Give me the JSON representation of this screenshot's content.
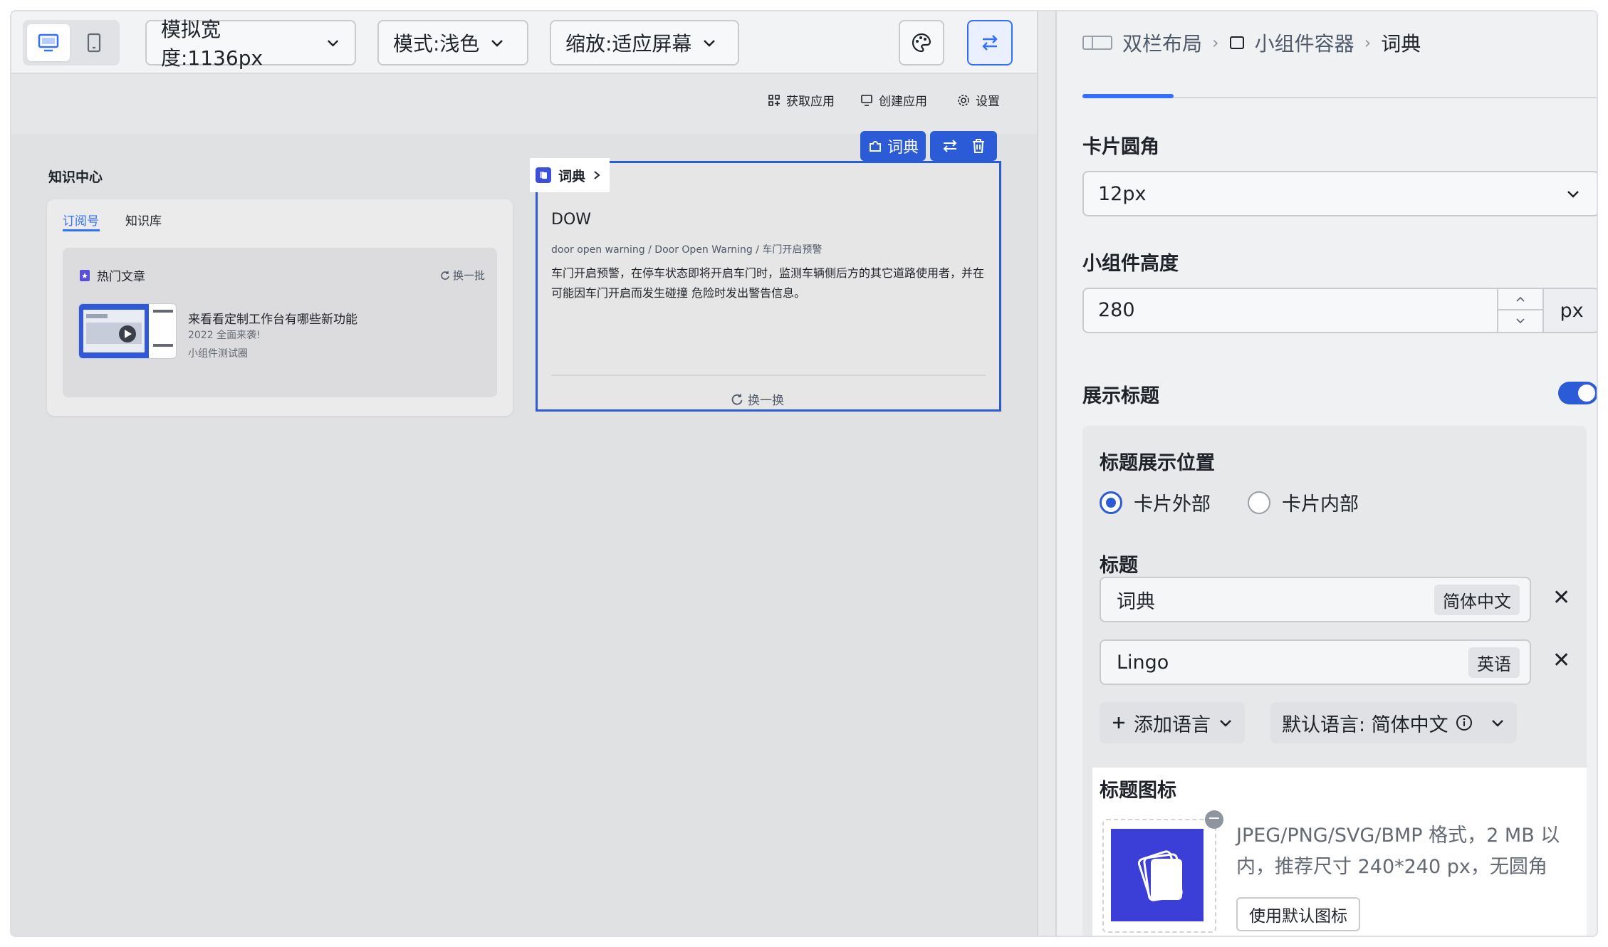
{
  "toolbar": {
    "width_label": "模拟宽度:1136px",
    "mode_label": "模式:浅色",
    "zoom_label": "缩放:适应屏幕"
  },
  "subbar": {
    "get_app": "获取应用",
    "create_app": "创建应用",
    "settings": "设置"
  },
  "canvas": {
    "knowledge_center": {
      "title": "知识中心",
      "tabs": [
        "订阅号",
        "知识库"
      ],
      "hot": {
        "title": "热门文章",
        "refresh": "换一批",
        "article_title": "来看看定制工作台有哪些新功能",
        "article_sub": "2022 全面来袭!",
        "article_meta": "小组件测试圈"
      }
    },
    "dictionary": {
      "tag_label": "词典",
      "toolbar_label": "词典",
      "word": "DOW",
      "phonetic": "door open warning / Door Open Warning / 车门开启预警",
      "definition": "车门开启预警，在停车状态即将开启车门时，监测车辆侧后方的其它道路使用者，并在可能因车门开启而发生碰撞 危险时发出警告信息。",
      "refresh": "换一换"
    }
  },
  "panel": {
    "breadcrumb": [
      "双栏布局",
      "小组件容器",
      "词典"
    ],
    "corner_label": "卡片圆角",
    "corner_value": "12px",
    "height_label": "小组件高度",
    "height_value": "280",
    "height_unit": "px",
    "show_title_label": "展示标题",
    "title_position_label": "标题展示位置",
    "position_options": [
      "卡片外部",
      "卡片内部"
    ],
    "title_label": "标题",
    "titles": [
      {
        "value": "词典",
        "lang": "简体中文"
      },
      {
        "value": "Lingo",
        "lang": "英语"
      }
    ],
    "add_language": "添加语言",
    "default_language": "默认语言: 简体中文",
    "icon_label": "标题图标",
    "icon_hint": "JPEG/PNG/SVG/BMP 格式，2 MB 以内，推荐尺寸 240*240 px，无圆角",
    "use_default_icon": "使用默认图标"
  },
  "colors": {
    "accent": "#2b5bd7",
    "link": "#3370ff"
  }
}
